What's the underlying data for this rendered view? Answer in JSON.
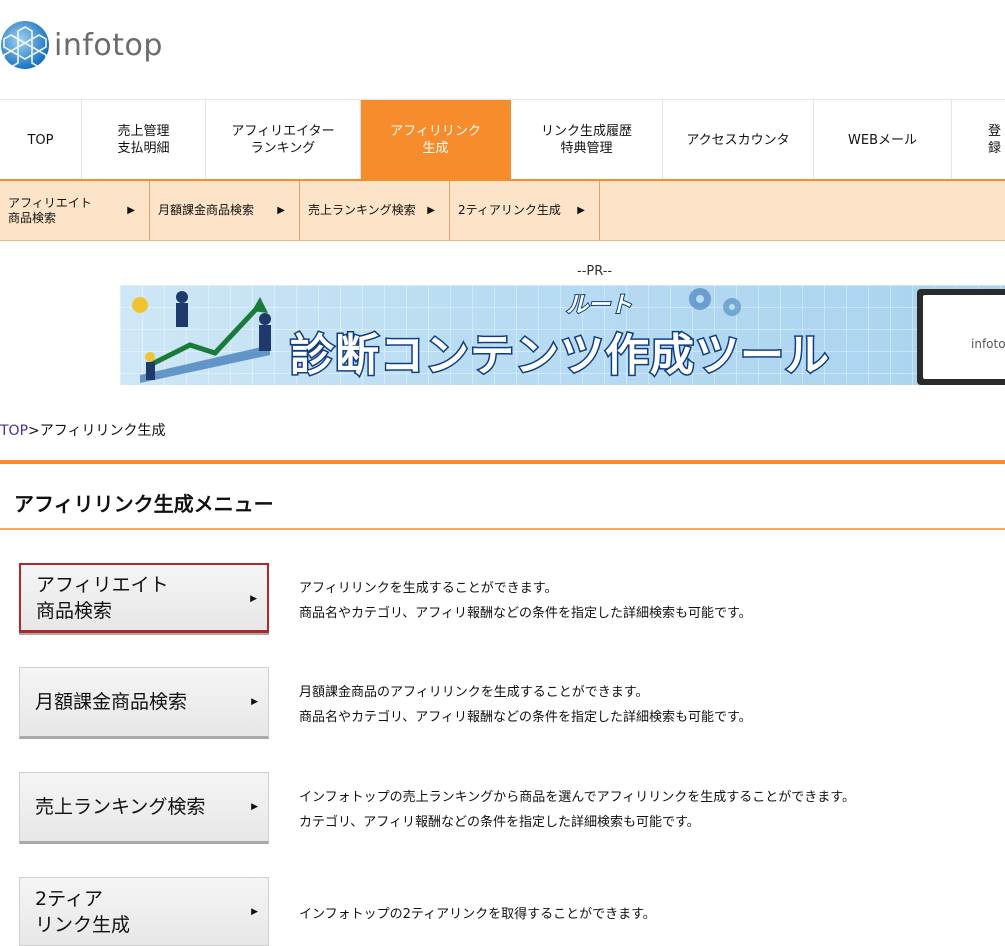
{
  "logo": {
    "text": "infotop"
  },
  "main_nav": [
    {
      "label": "TOP"
    },
    {
      "label": "売上管理\n支払明細"
    },
    {
      "label": "アフィリエイター\nランキング"
    },
    {
      "label": "アフィリリンク\n生成"
    },
    {
      "label": "リンク生成履歴\n特典管理"
    },
    {
      "label": "アクセスカウンタ"
    },
    {
      "label": "WEBメール"
    },
    {
      "label": "登録"
    }
  ],
  "sub_nav": [
    {
      "label": "アフィリエイト\n商品検索"
    },
    {
      "label": "月額課金商品検索"
    },
    {
      "label": "売上ランキング検索"
    },
    {
      "label": "2ティアリンク生成"
    }
  ],
  "pr": {
    "label": "--PR--",
    "banner_title": "診断コンテンツ作成ツール",
    "banner_sub": "ルート",
    "screen_brand": "infotop"
  },
  "breadcrumb": {
    "home": "TOP",
    "separator": ">",
    "current": "アフィリリンク生成"
  },
  "section": {
    "title": "アフィリリンク生成メニュー"
  },
  "menu": [
    {
      "label": "アフィリエイト\n商品検索",
      "desc": "アフィリリンクを生成することができます。\n商品名やカテゴリ、アフィリ報酬などの条件を指定した詳細検索も可能です。"
    },
    {
      "label": "月額課金商品検索",
      "desc": "月額課金商品のアフィリリンクを生成することができます。\n商品名やカテゴリ、アフィリ報酬などの条件を指定した詳細検索も可能です。"
    },
    {
      "label": "売上ランキング検索",
      "desc": "インフォトップの売上ランキングから商品を選んでアフィリリンクを生成することができます。\nカテゴリ、アフィリ報酬などの条件を指定した詳細検索も可能です。"
    },
    {
      "label": "2ティア\nリンク生成",
      "desc": "インフォトップの2ティアリンクを取得することができます。"
    }
  ],
  "colors": {
    "accent": "#f68c2b",
    "subnav_bg": "#fde3c7",
    "active_border": "#b0282b",
    "breadcrumb_link": "#4a2ea0"
  },
  "icons": {
    "arrow": "right-triangle-icon",
    "logo": "globe-hex-icon"
  }
}
